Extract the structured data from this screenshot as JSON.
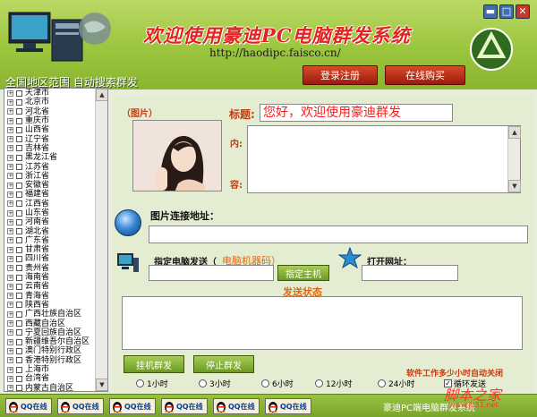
{
  "window": {
    "title": "欢迎使用豪迪PC电脑群发系统",
    "url": "http://haodipc.faisco.cn/",
    "subtitle": "全国地区范围 自动搜索群发",
    "controls": {
      "minimize": "▬",
      "maximize": "□",
      "close": "✕"
    }
  },
  "header": {
    "login_label": "登录注册",
    "buy_label": "在线购买"
  },
  "regions": [
    "天津市",
    "北京市",
    "河北省",
    "重庆市",
    "山西省",
    "辽宁省",
    "吉林省",
    "黑龙江省",
    "江苏省",
    "浙江省",
    "安徽省",
    "福建省",
    "江西省",
    "山东省",
    "河南省",
    "湖北省",
    "广东省",
    "甘肃省",
    "四川省",
    "贵州省",
    "海南省",
    "云南省",
    "青海省",
    "陕西省",
    "广西壮族自治区",
    "西藏自治区",
    "宁夏回族自治区",
    "新疆维吾尔自治区",
    "澳门特别行政区",
    "香港特别行政区",
    "上海市",
    "台湾省",
    "内蒙古自治区"
  ],
  "form": {
    "picture_label": "（图片）",
    "title_label": "标题:",
    "title_value": "您好，欢迎使用豪迪群发",
    "content_label_top": "内:",
    "content_label_bottom": "容:",
    "image_url_label": "图片连接地址：",
    "target_label": "指定电脑发送（",
    "machine_code_label": "电脑机器码）",
    "host_button": "指定主机",
    "open_url_label": "打开网址：",
    "status_label": "发送状态",
    "start_button": "挂机群发",
    "stop_button": "停止群发",
    "auto_close_label": "软件工作多少小时自动关闭"
  },
  "hours": [
    {
      "label": "1小时",
      "selected": false
    },
    {
      "label": "3小时",
      "selected": false
    },
    {
      "label": "6小时",
      "selected": false
    },
    {
      "label": "12小时",
      "selected": false
    },
    {
      "label": "24小时",
      "selected": false
    }
  ],
  "loop_label": "循环发送",
  "bottom": {
    "qq_buttons": [
      "QQ在线",
      "QQ在线",
      "QQ在线",
      "QQ在线",
      "QQ在线",
      "QQ在线"
    ],
    "footer_text": "豪迪PC端电脑群发系统",
    "watermark": "脚本之家",
    "watermark_sub": "www.jb51.net"
  },
  "colors": {
    "header_green": "#9cc53e",
    "accent_red": "#e52222",
    "label_orange": "#c33d11"
  }
}
